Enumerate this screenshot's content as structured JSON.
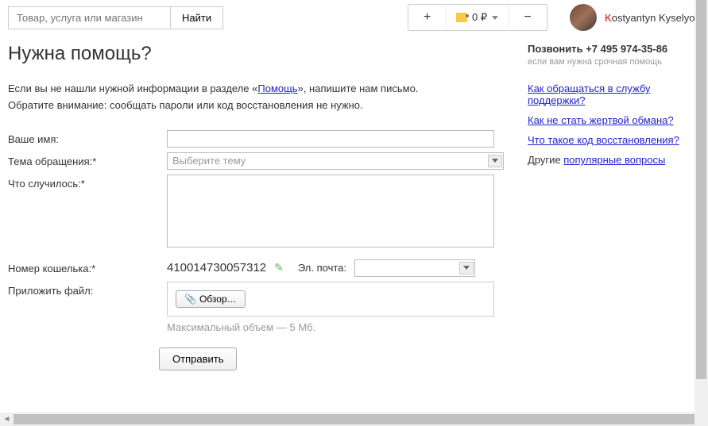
{
  "header": {
    "search_placeholder": "Товар, услуга или магазин",
    "search_btn": "Найти",
    "balance": "0 ₽",
    "username_first": "K",
    "username_rest": "ostyantyn Kyselyov"
  },
  "title": "Нужна помощь?",
  "intro_line1_before": "Если вы не нашли нужной информации в разделе «",
  "intro_link": "Помощь",
  "intro_line1_after": "», напишите нам письмо.",
  "intro_line2": "Обратите внимание: сообщать пароли или код восстановления не нужно.",
  "form": {
    "name_label": "Ваше имя:",
    "subject_label": "Тема обращения:*",
    "subject_placeholder": "Выберите тему",
    "desc_label": "Что случилось:*",
    "wallet_label": "Номер кошелька:*",
    "wallet_value": "410014730057312",
    "email_label": "Эл. почта:",
    "attach_label": "Приложить файл:",
    "browse_btn": "Обзор…",
    "file_note": "Максимальный объем — 5 Мб.",
    "submit": "Отправить"
  },
  "sidebar": {
    "call_label": "Позвонить ",
    "call_phone": "+7 495 974-35-86",
    "call_sub": "если вам нужна срочная помощь",
    "link1": "Как обращаться в службу поддержки?",
    "link2": "Как не стать жертвой обмана?",
    "link3": "Что такое код восстановления?",
    "other_prefix": "Другие ",
    "other_link": "популярные вопросы"
  }
}
